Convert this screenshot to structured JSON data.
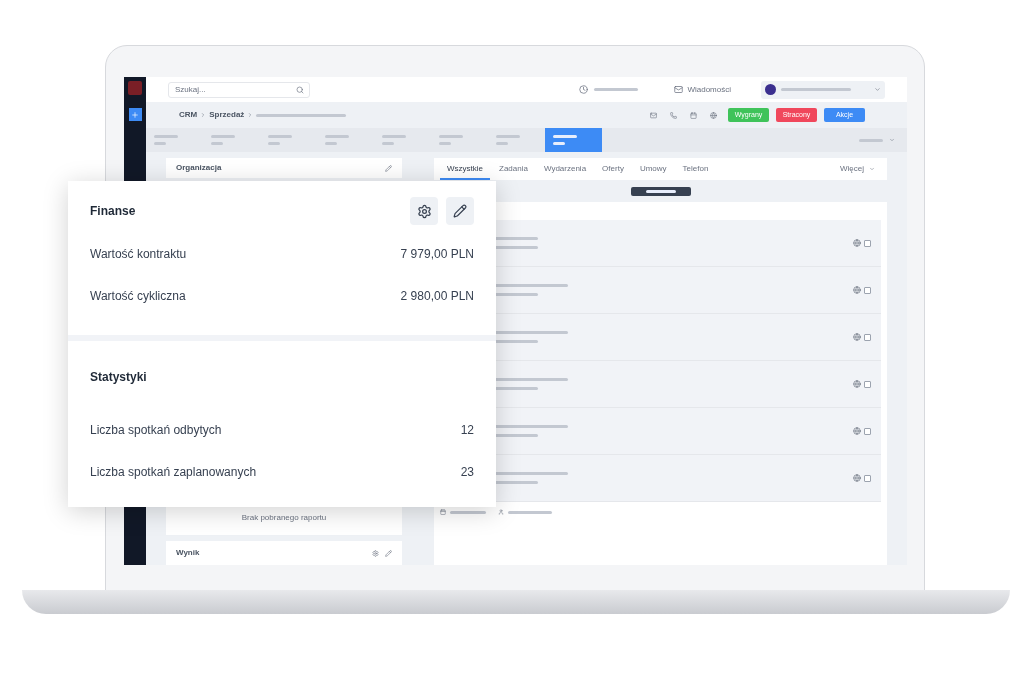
{
  "topbar": {
    "search_placeholder": "Szukaj...",
    "messages": "Wiadomości"
  },
  "breadcrumb": [
    "CRM",
    "Sprzedaż"
  ],
  "actions": [
    {
      "label": "Wygrany",
      "kind": "won"
    },
    {
      "label": "Stracony",
      "kind": "lost"
    },
    {
      "label": "Akcje",
      "kind": "menu"
    }
  ],
  "stages": [
    {
      "selected": false
    },
    {
      "selected": false
    },
    {
      "selected": false
    },
    {
      "selected": false
    },
    {
      "selected": false
    },
    {
      "selected": false
    },
    {
      "selected": false
    },
    {
      "selected": true
    }
  ],
  "left_panels": [
    {
      "title": "Organizacja"
    },
    {
      "title": "Wynik"
    }
  ],
  "report_empty": "Brak pobranego raportu",
  "tabs": [
    {
      "label": "Wszystkie",
      "selected": true
    },
    {
      "label": "Zadania",
      "selected": false
    },
    {
      "label": "Wydarzenia",
      "selected": false
    },
    {
      "label": "Oferty",
      "selected": false
    },
    {
      "label": "Umowy",
      "selected": false
    },
    {
      "label": "Telefon",
      "selected": false
    }
  ],
  "tabs_more": "Więcej",
  "files": [
    {
      "checked": false
    },
    {
      "checked": false
    },
    {
      "checked": false
    },
    {
      "checked": false
    },
    {
      "checked": false
    },
    {
      "checked": false
    }
  ],
  "card": {
    "sections": [
      {
        "title": "Finanse",
        "rows": [
          {
            "label": "Wartość kontraktu",
            "value": "7 979,00 PLN"
          },
          {
            "label": "Wartość cykliczna",
            "value": "2 980,00 PLN"
          }
        ]
      },
      {
        "title": "Statystyki",
        "rows": [
          {
            "label": "Liczba spotkań odbytych",
            "value": "12"
          },
          {
            "label": "Liczba spotkań zaplanowanych",
            "value": "23"
          }
        ]
      }
    ]
  }
}
